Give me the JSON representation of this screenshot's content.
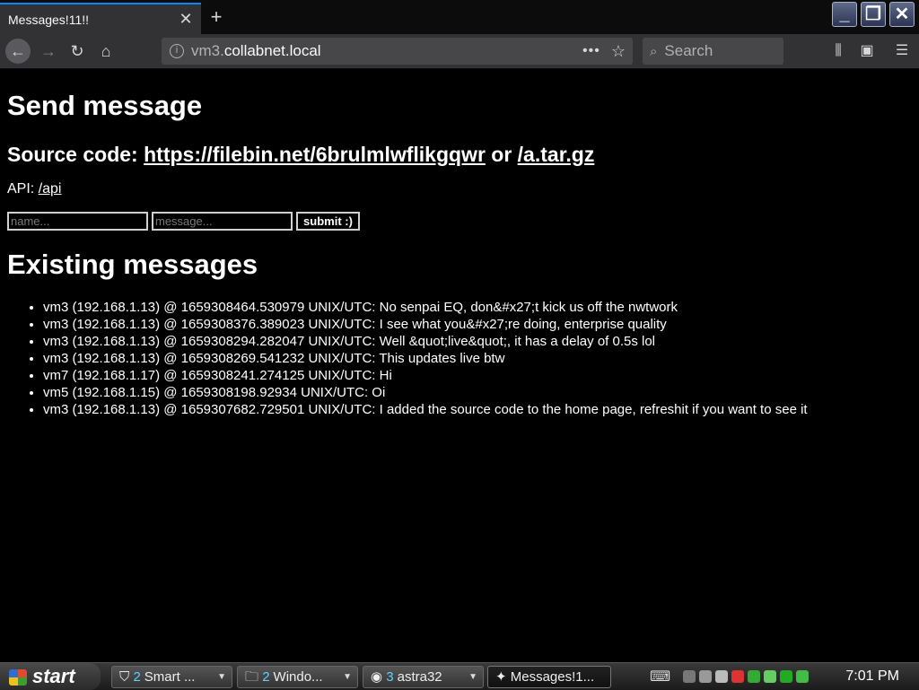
{
  "browser": {
    "tab_title": "Messages!11!!",
    "tab_close": "✕",
    "new_tab": "+",
    "url_dim_prefix": "vm3.",
    "url_domain": "collabnet.local",
    "url_more": "•••",
    "search_placeholder": "Search"
  },
  "page": {
    "title": "Send message",
    "source_prefix": "Source code: ",
    "source_link": "https://filebin.net/6brulmlwflikgqwr",
    "source_or": " or ",
    "source_link2": "/a.tar.gz",
    "api_label": "API: ",
    "api_link": "/api",
    "name_placeholder": "name...",
    "message_placeholder": "message...",
    "submit_label": "submit :)",
    "existing_title": "Existing messages",
    "messages": [
      "vm3 (192.168.1.13) @ 1659308464.530979 UNIX/UTC: No senpai EQ, don&#x27;t kick us off the nwtwork",
      "vm3 (192.168.1.13) @ 1659308376.389023 UNIX/UTC: I see what you&#x27;re doing, enterprise quality",
      "vm3 (192.168.1.13) @ 1659308294.282047 UNIX/UTC: Well &quot;live&quot;, it has a delay of 0.5s lol",
      "vm3 (192.168.1.13) @ 1659308269.541232 UNIX/UTC: This updates live btw",
      "vm7 (192.168.1.17) @ 1659308241.274125 UNIX/UTC: Hi",
      "vm5 (192.168.1.15) @ 1659308198.92934 UNIX/UTC: Oi",
      "vm3 (192.168.1.13) @ 1659307682.729501 UNIX/UTC: I added the source code to the home page, refreshit if you want to see it"
    ]
  },
  "taskbar": {
    "start_label": "start",
    "tasks": [
      {
        "num": "2",
        "label": "Smart ..."
      },
      {
        "num": "2",
        "label": "Windo..."
      },
      {
        "num": "3",
        "label": "astra32"
      },
      {
        "num": "",
        "label": "Messages!1..."
      }
    ],
    "clock": "7:01 PM"
  }
}
